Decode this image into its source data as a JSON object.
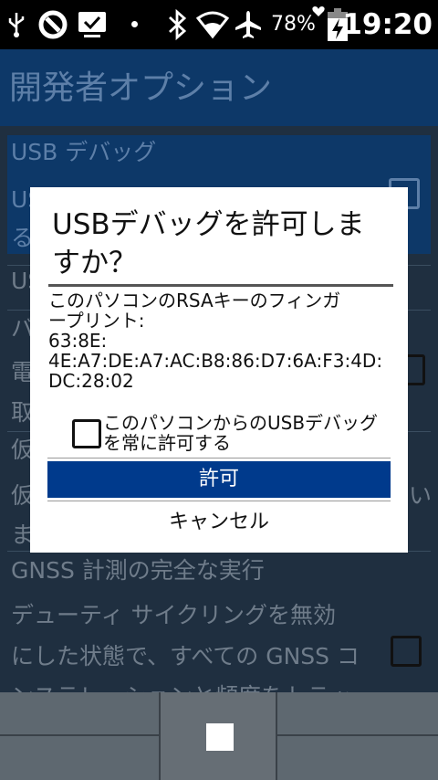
{
  "status_bar": {
    "battery_percent": "78%",
    "time": "19:20"
  },
  "settings": {
    "title": "開発者オプション",
    "rows": [
      "USB デバッグ",
      "US",
      "る",
      "US",
      "バ",
      "電",
      "取",
      "仮",
      "仮",
      "い",
      "ま",
      "GNSS 計測の完全な実行",
      "デューティ サイクリングを無効",
      "にした状態で、すべての GNSS コ",
      "ンステレーションと頻度をトラッ"
    ]
  },
  "dialog": {
    "title": "USBデバッグを許可しますか？",
    "message_lines": [
      "このパソコンのRSAキーのフィンガ",
      "ープリント:",
      "63:8E:",
      "4E:A7:DE:A7:AC:B8:86:D7:6A:F3:4D:",
      "DC:28:02"
    ],
    "always_allow_label": "このパソコンからのUSBデバッグを常に許可する",
    "always_allow_checked": false,
    "allow_button": "許可",
    "cancel_button": "キャンセル"
  }
}
